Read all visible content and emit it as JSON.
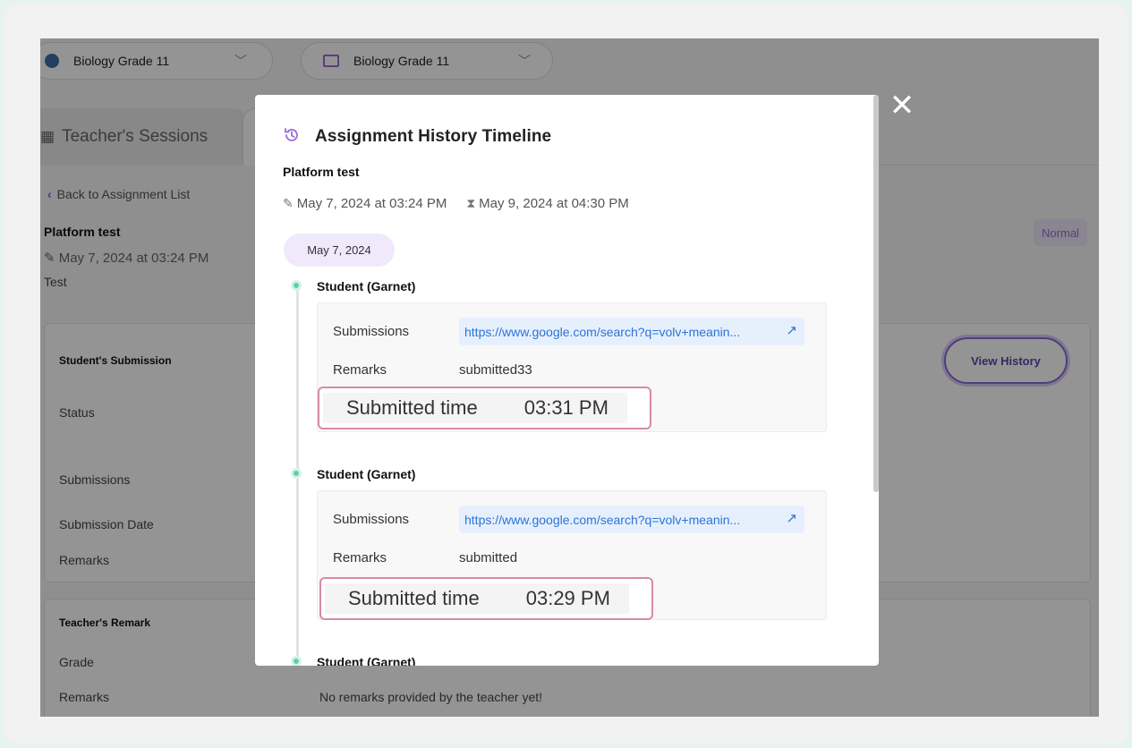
{
  "background": {
    "class_selector": "Biology Grade 11",
    "room_selector": "Biology Grade 11",
    "tab_label": "Teacher's Sessions",
    "back_link": "Back to Assignment List",
    "assignment_title": "Platform test",
    "assignment_date": "May 7, 2024 at 03:24 PM",
    "assignment_desc": "Test",
    "priority_badge": "Normal",
    "submission_panel": {
      "heading": "Student's Submission",
      "rows": [
        "Status",
        "Submissions",
        "Submission Date",
        "Remarks"
      ],
      "view_history_label": "View History"
    },
    "teacher_panel": {
      "heading": "Teacher's Remark",
      "rows": [
        "Grade",
        "Remarks"
      ],
      "remarks_value": "No remarks provided by the teacher yet!"
    }
  },
  "modal": {
    "title": "Assignment History Timeline",
    "assignment_name": "Platform test",
    "created": "May 7, 2024 at 03:24 PM",
    "due": "May 9, 2024 at 04:30 PM",
    "date_pill": "May 7, 2024",
    "entries": [
      {
        "student": "Student (Garnet)",
        "submissions_label": "Submissions",
        "link": "https://www.google.com/search?q=volv+meanin...",
        "remarks_label": "Remarks",
        "remarks": "submitted33",
        "time_label": "Submitted time",
        "time": "03:31 PM"
      },
      {
        "student": "Student (Garnet)",
        "submissions_label": "Submissions",
        "link": "https://www.google.com/search?q=volv+meanin...",
        "remarks_label": "Remarks",
        "remarks": "submitted",
        "time_label": "Submitted time",
        "time": "03:29 PM"
      },
      {
        "student": "Student (Garnet)"
      }
    ],
    "close_icon": "close-icon"
  },
  "colors": {
    "accent": "#8a6ad8",
    "timeline_dot": "#5fd0a9",
    "link": "#2b73d8",
    "highlight_border": "#d98aa3"
  }
}
